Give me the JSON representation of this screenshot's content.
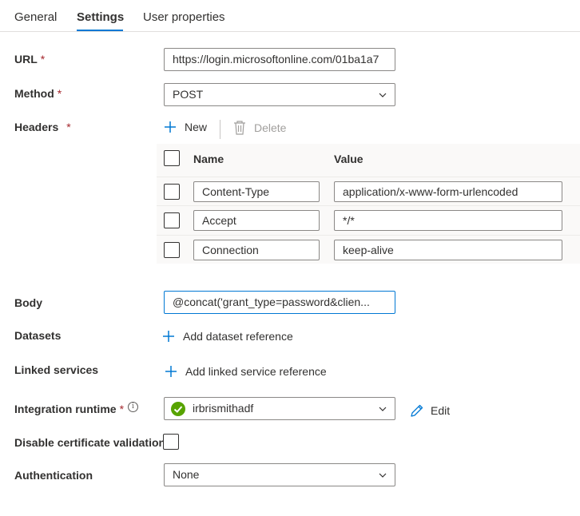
{
  "tabs": [
    {
      "label": "General"
    },
    {
      "label": "Settings"
    },
    {
      "label": "User properties"
    }
  ],
  "url": {
    "label": "URL",
    "required": "*",
    "value": "https://login.microsoftonline.com/01ba1a7"
  },
  "method": {
    "label": "Method",
    "required": "*",
    "value": "POST"
  },
  "headers": {
    "label": "Headers",
    "required": "*",
    "new_label": "New",
    "delete_label": "Delete",
    "col_name": "Name",
    "col_value": "Value",
    "rows": [
      {
        "name": "Content-Type",
        "value": "application/x-www-form-urlencoded"
      },
      {
        "name": "Accept",
        "value": "*/*"
      },
      {
        "name": "Connection",
        "value": "keep-alive"
      }
    ]
  },
  "body": {
    "label": "Body",
    "value": "@concat('grant_type=password&clien..."
  },
  "datasets": {
    "label": "Datasets",
    "add_label": "Add dataset reference"
  },
  "linked_services": {
    "label": "Linked services",
    "add_label": "Add linked service reference"
  },
  "integration_runtime": {
    "label": "Integration runtime",
    "required": "*",
    "value": "irbrismithadf",
    "edit_label": "Edit",
    "status_color": "#57a300"
  },
  "disable_cert": {
    "label": "Disable certificate validation"
  },
  "authentication": {
    "label": "Authentication",
    "value": "None"
  },
  "colors": {
    "accent": "#0078d4",
    "required": "#a4262c"
  }
}
